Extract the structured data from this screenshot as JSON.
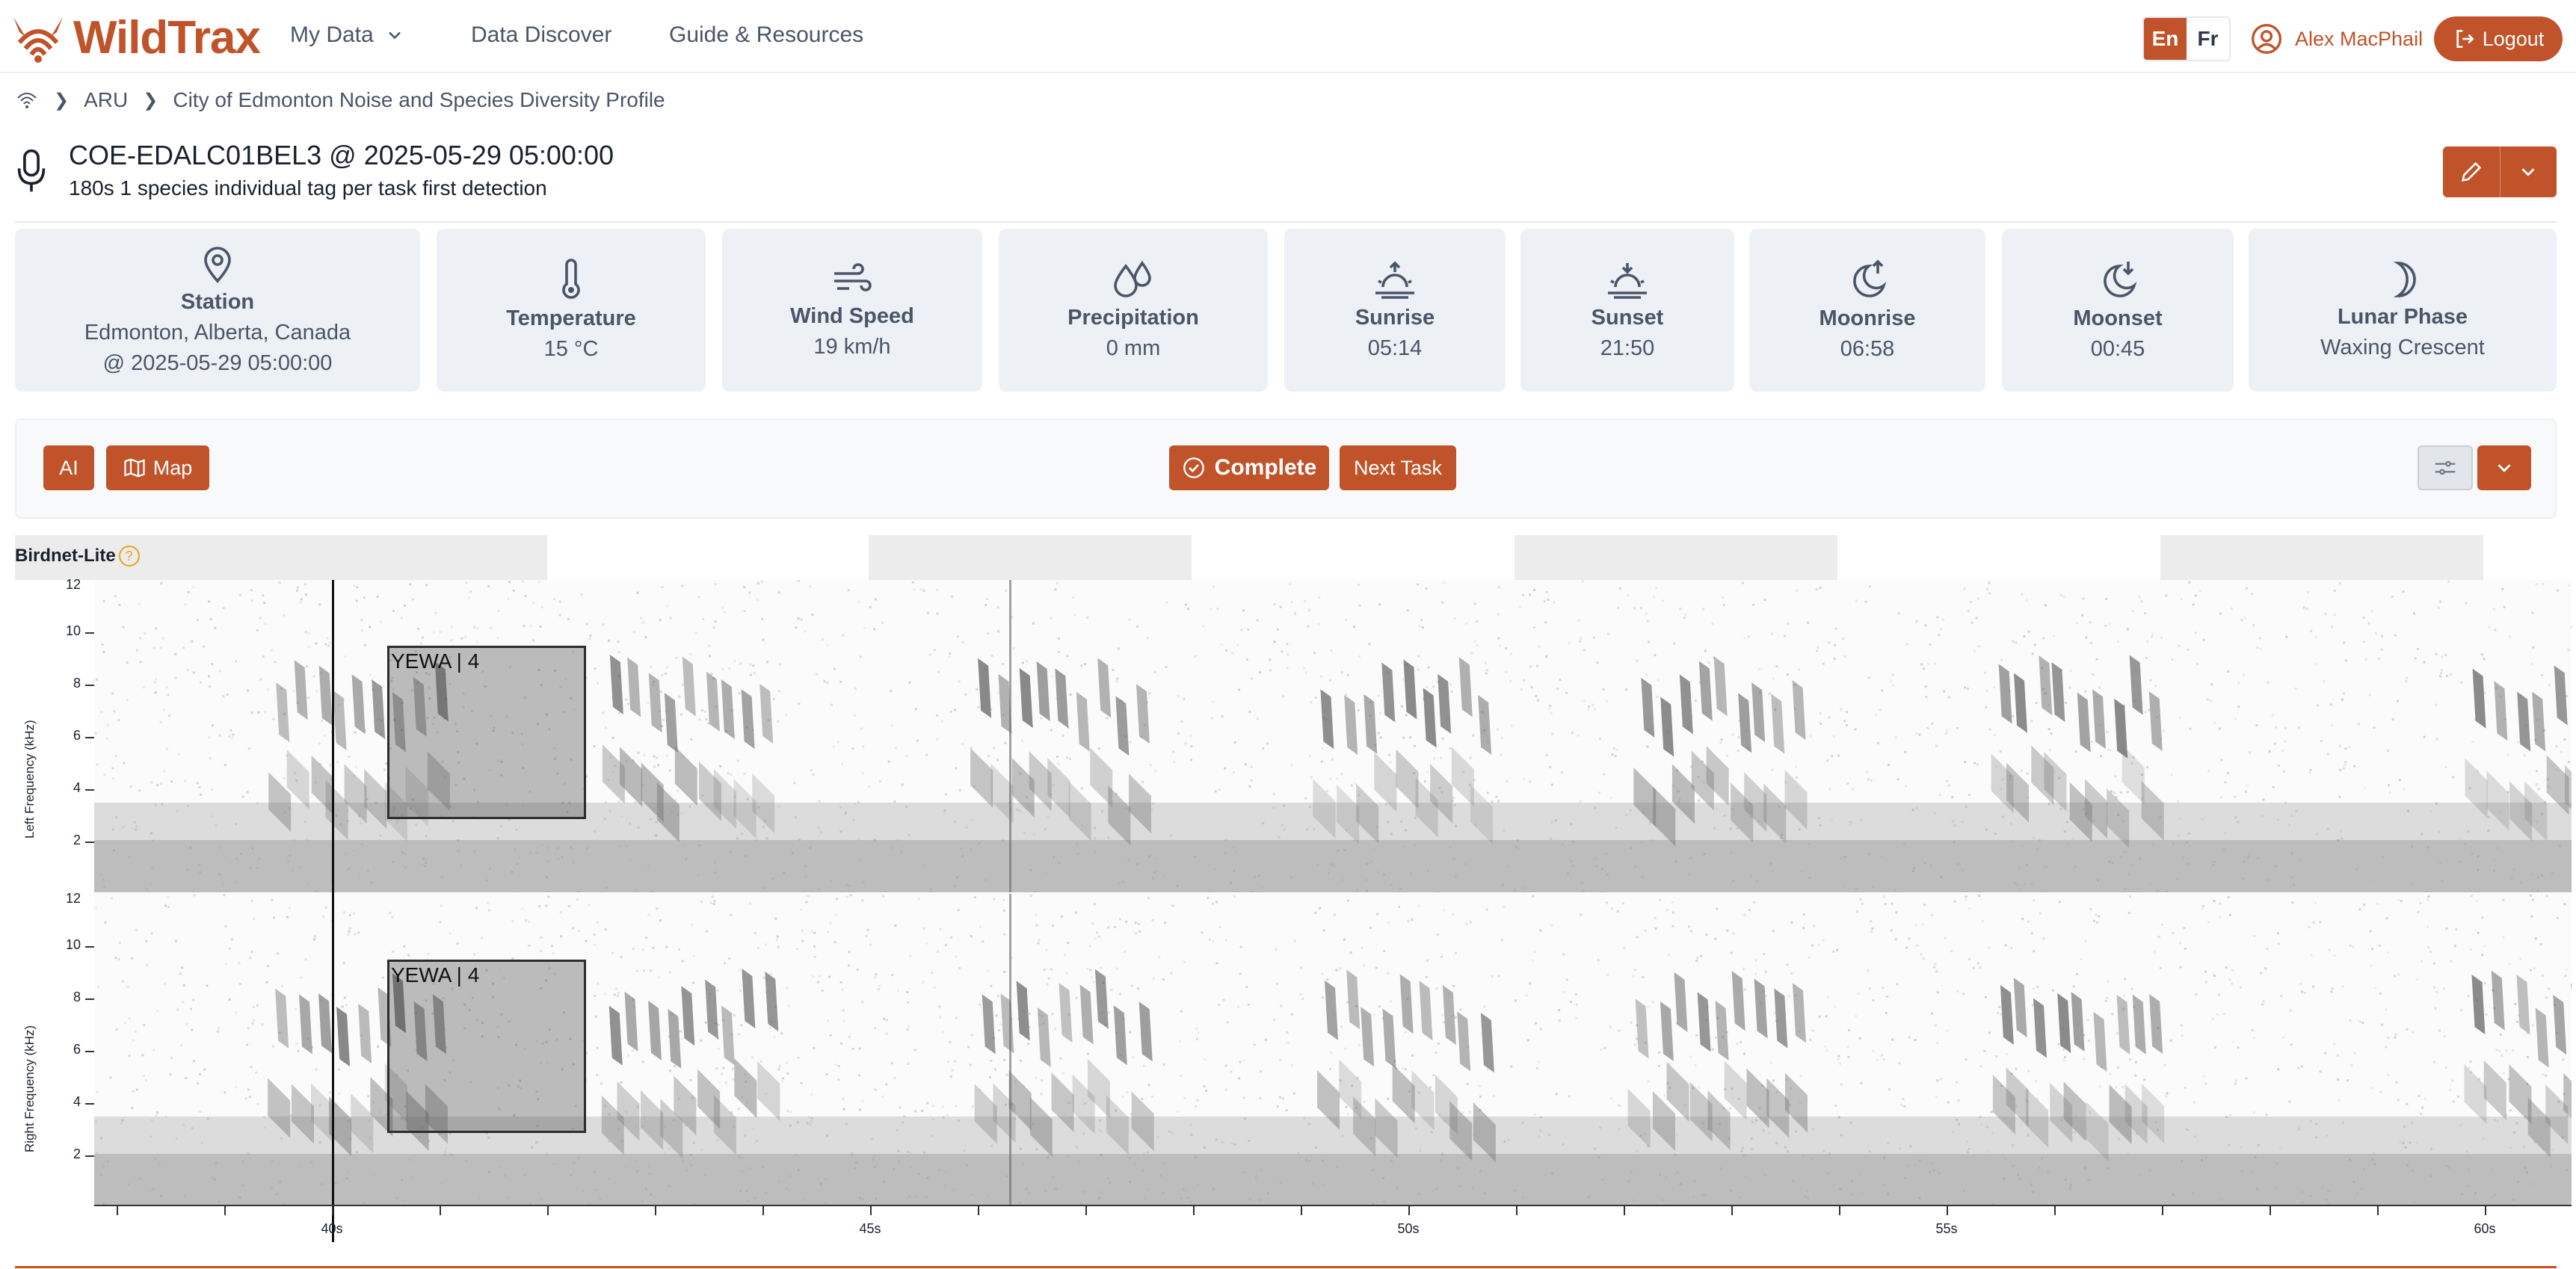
{
  "app": {
    "brand": "WildTrax",
    "accent": "#c0532a"
  },
  "nav": {
    "my_data": "My Data",
    "data_discover": "Data Discover",
    "guide": "Guide & Resources"
  },
  "lang": {
    "en": "En",
    "fr": "Fr",
    "active": "En"
  },
  "user": {
    "name": "Alex MacPhail",
    "logout": "Logout"
  },
  "breadcrumb": {
    "item1": "ARU",
    "item2": "City of Edmonton Noise and Species Diversity Profile"
  },
  "task": {
    "title": "COE-EDALC01BEL3 @ 2025-05-29 05:00:00",
    "subtitle": "180s 1 species individual tag per task first detection"
  },
  "cards": {
    "station": {
      "title": "Station",
      "line1": "Edmonton, Alberta, Canada",
      "line2": "@ 2025-05-29 05:00:00",
      "icon": "map-pin-icon"
    },
    "temperature": {
      "title": "Temperature",
      "value": "15 °C",
      "icon": "thermometer-icon"
    },
    "wind": {
      "title": "Wind Speed",
      "value": "19 km/h",
      "icon": "wind-icon"
    },
    "precip": {
      "title": "Precipitation",
      "value": "0 mm",
      "icon": "droplets-icon"
    },
    "sunrise": {
      "title": "Sunrise",
      "value": "05:14",
      "icon": "sunrise-icon"
    },
    "sunset": {
      "title": "Sunset",
      "value": "21:50",
      "icon": "sunset-icon"
    },
    "moonrise": {
      "title": "Moonrise",
      "value": "06:58",
      "icon": "moonrise-icon"
    },
    "moonset": {
      "title": "Moonset",
      "value": "00:45",
      "icon": "moonset-icon"
    },
    "lunar": {
      "title": "Lunar Phase",
      "value": "Waxing Crescent",
      "icon": "moon-crescent-icon"
    }
  },
  "toolbar": {
    "ai": "AI",
    "map": "Map",
    "complete": "Complete",
    "next_task": "Next Task"
  },
  "spectrogram": {
    "classifier": "Birdnet-Lite",
    "left_axis_title": "Left Frequency (kHz)",
    "right_axis_title": "Right Frequency (kHz)",
    "y_ticks": [
      "12",
      "10",
      "8",
      "6",
      "4",
      "2"
    ],
    "x_labels": [
      "40s",
      "45s",
      "50s",
      "55s",
      "60s"
    ],
    "tags": [
      {
        "label": "YEWA | 4",
        "channel": "left",
        "start_s": 40.4,
        "end_s": 42.2,
        "low_khz": 2.8,
        "high_khz": 9.5
      },
      {
        "label": "YEWA | 4",
        "channel": "right",
        "start_s": 40.4,
        "end_s": 42.2,
        "low_khz": 2.8,
        "high_khz": 9.5
      }
    ],
    "cursor_s": 40.0,
    "view_start_s": 37.85,
    "view_end_s": 60.7
  }
}
